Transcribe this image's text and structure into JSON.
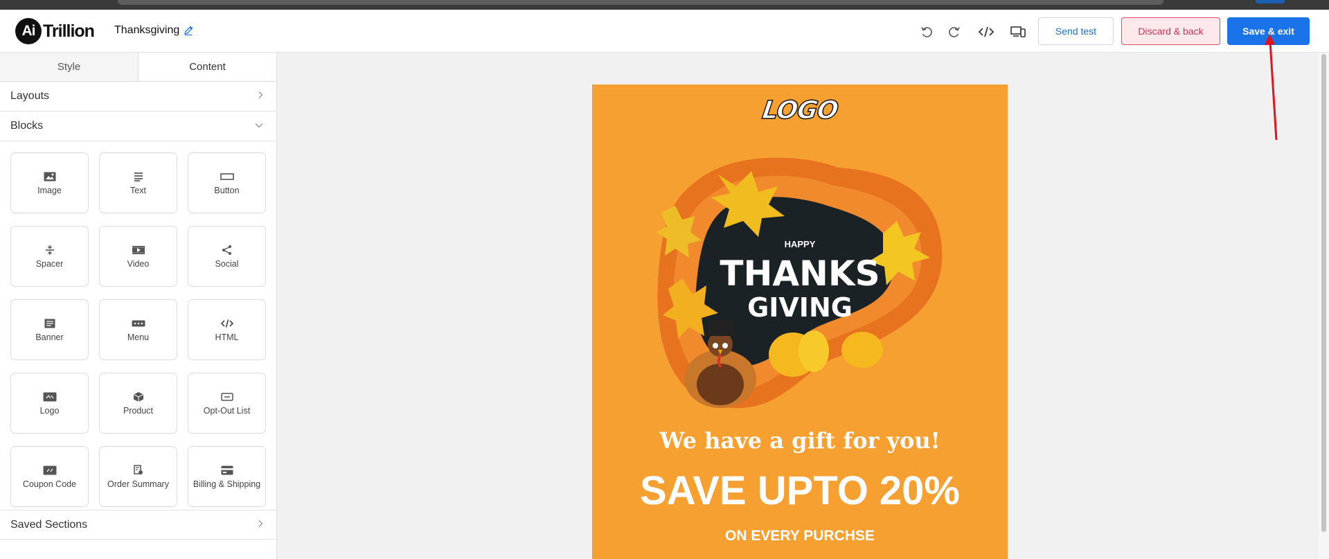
{
  "brand": {
    "badge": "Ai",
    "name": "Trillion"
  },
  "campaign": {
    "name": "Thanksgiving"
  },
  "toolbar": {
    "undo_icon": "undo-icon",
    "redo_icon": "redo-icon",
    "code_icon": "code-icon",
    "preview_icon": "devices-icon",
    "send_test": "Send test",
    "discard": "Discard & back",
    "save": "Save & exit"
  },
  "sidebar": {
    "tabs": [
      {
        "label": "Style"
      },
      {
        "label": "Content"
      }
    ],
    "active_tab": "Content",
    "layouts": "Layouts",
    "blocks_title": "Blocks",
    "blocks": [
      {
        "label": "Image",
        "icon": "image-icon"
      },
      {
        "label": "Text",
        "icon": "text-icon"
      },
      {
        "label": "Button",
        "icon": "button-icon"
      },
      {
        "label": "Spacer",
        "icon": "spacer-icon"
      },
      {
        "label": "Video",
        "icon": "video-icon"
      },
      {
        "label": "Social",
        "icon": "share-icon"
      },
      {
        "label": "Banner",
        "icon": "banner-icon"
      },
      {
        "label": "Menu",
        "icon": "menu-icon"
      },
      {
        "label": "HTML",
        "icon": "code-icon"
      },
      {
        "label": "Logo",
        "icon": "logo-icon"
      },
      {
        "label": "Product",
        "icon": "product-icon"
      },
      {
        "label": "Opt-Out List",
        "icon": "optout-icon"
      },
      {
        "label": "Coupon Code",
        "icon": "coupon-icon"
      },
      {
        "label": "Order Summary",
        "icon": "order-icon"
      },
      {
        "label": "Billing & Shipping",
        "icon": "card-icon"
      }
    ],
    "saved_sections": "Saved Sections"
  },
  "email": {
    "logo_text": "LOGO",
    "hero": {
      "small": "HAPPY",
      "line1": "THANKS",
      "line2": "GIVING"
    },
    "headline": "We have a gift for you!",
    "offer": "SAVE UPTO 20%",
    "subline": "ON EVERY PURCHSE"
  },
  "colors": {
    "accent_blue": "#1a73e8",
    "discard_red": "#c9344f",
    "email_orange": "#f5a030",
    "annotation_red": "#e0141f"
  }
}
